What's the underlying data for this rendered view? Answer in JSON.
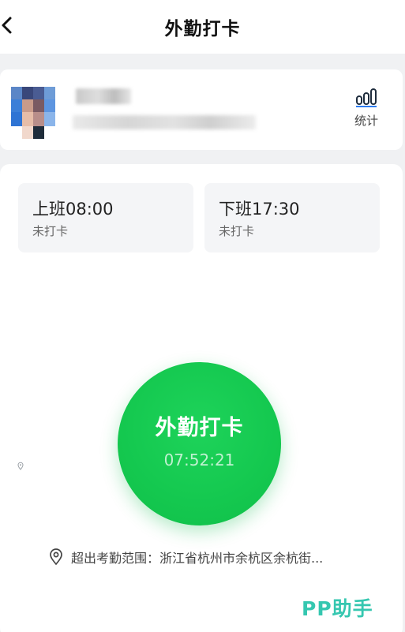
{
  "header": {
    "title": "外勤打卡",
    "back_icon": "chevron-left-icon"
  },
  "user": {
    "stats_label": "统计",
    "stats_icon": "bar-chart-icon"
  },
  "shifts": [
    {
      "title": "上班08:00",
      "status": "未打卡"
    },
    {
      "title": "下班17:30",
      "status": "未打卡"
    }
  ],
  "punch": {
    "label": "外勤打卡",
    "time": "07:52:21",
    "color": "#14c84f"
  },
  "location": {
    "icon": "location-pin-icon",
    "text": "超出考勤范围：浙江省杭州市余杭区余杭街..."
  },
  "watermark": {
    "text": "PP助手",
    "color": "#35c7b0"
  }
}
